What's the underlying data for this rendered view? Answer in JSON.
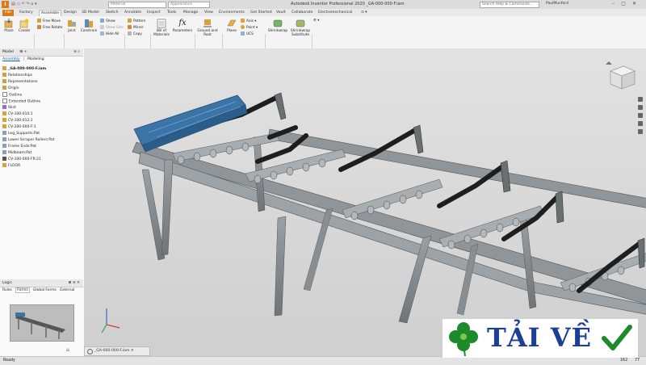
{
  "app": {
    "logo_letter": "I",
    "title": "Autodesk Inventor Professional 2020  _GA-000-000-F.iam",
    "material_placeholder": "Material",
    "appearance_placeholder": "Appearance",
    "search_placeholder": "Search Help & Commands...",
    "user": "PaulMunford"
  },
  "tabs": [
    "File",
    "Factory",
    "Assemble",
    "Design",
    "3D Model",
    "Sketch",
    "Annotate",
    "Inspect",
    "Tools",
    "Manage",
    "View",
    "Environments",
    "Get Started",
    "Vault",
    "Collaborate",
    "Electromechanical"
  ],
  "active_tab": "Assemble",
  "ribbon": {
    "component": {
      "place": "Place",
      "create": "Create",
      "label": "Component"
    },
    "position": {
      "free_move": "Free Move",
      "free_rotate": "Free Rotate",
      "label": "Position"
    },
    "relationships": {
      "joint": "Joint",
      "constrain": "Constrain",
      "show": "Show",
      "show_sick": "Show Sick",
      "hide_all": "Hide All",
      "label": "Relationships"
    },
    "pattern": {
      "pattern": "Pattern",
      "mirror": "Mirror",
      "copy": "Copy",
      "label": "Pattern"
    },
    "manage": {
      "bom": "Bill of Materials",
      "parameters": "Parameters",
      "label": "Manage"
    },
    "productivity": {
      "ground_root": "Ground and Root",
      "label": "Productivity"
    },
    "work_features": {
      "plane": "Plane",
      "axis": "Axis",
      "point": "Point",
      "ucs": "UCS",
      "label": "Work Features"
    },
    "simplification": {
      "shrinkwrap": "Shrinkwrap",
      "shrinkwrap_sub": "Shrinkwrap Substitute",
      "label": "Simplification"
    }
  },
  "browser": {
    "header": "Model",
    "tabs": [
      "Assembly",
      "Modeling"
    ],
    "root": "_GA-000-000-F.iam",
    "items": [
      "Relationships",
      "Representations",
      "Origin",
      "Outline",
      "Extended Outline",
      "Skid",
      "CV-100-010:1",
      "CV-100-012:1",
      "CV-200-000-F:1",
      "Leg_Supports:Pat",
      "Lower Scraper Rollers:Pat",
      "Frame Ends:Pat",
      "Midbeam:Pat",
      "CV-100-000-FR:21",
      "FLOOR"
    ]
  },
  "logic": {
    "header": "Logic",
    "tabs": [
      "Rules",
      "Forms",
      "Global Forms",
      "External"
    ]
  },
  "document_tab": "_GA-000-000-F.iam",
  "status": {
    "text": "Ready",
    "num1": "162",
    "num2": "77"
  },
  "watermark": {
    "text": "TẢI VỀ"
  },
  "colors": {
    "accent": "#d97a1a",
    "watermark_text": "#1b3f95",
    "watermark_green": "#1f8a2a",
    "conveyor_blue": "#3b74a6"
  }
}
